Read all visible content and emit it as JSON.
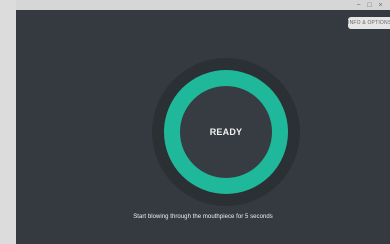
{
  "window": {
    "controls": {
      "minimize_symbol": "−",
      "maximize_symbol": "□",
      "close_symbol": "×"
    }
  },
  "toolbar": {
    "button_label": "INFO & OPTIONS"
  },
  "main": {
    "status_label": "READY",
    "instruction": "Start blowing through the mouthpiece for 5 seconds"
  },
  "colors": {
    "background": "#343a40",
    "ring_outer": "#2b3035",
    "ring_accent": "#20b89a",
    "ring_inner": "#363c42"
  },
  "icons": {
    "progress_ring": "circular-progress-ring"
  }
}
